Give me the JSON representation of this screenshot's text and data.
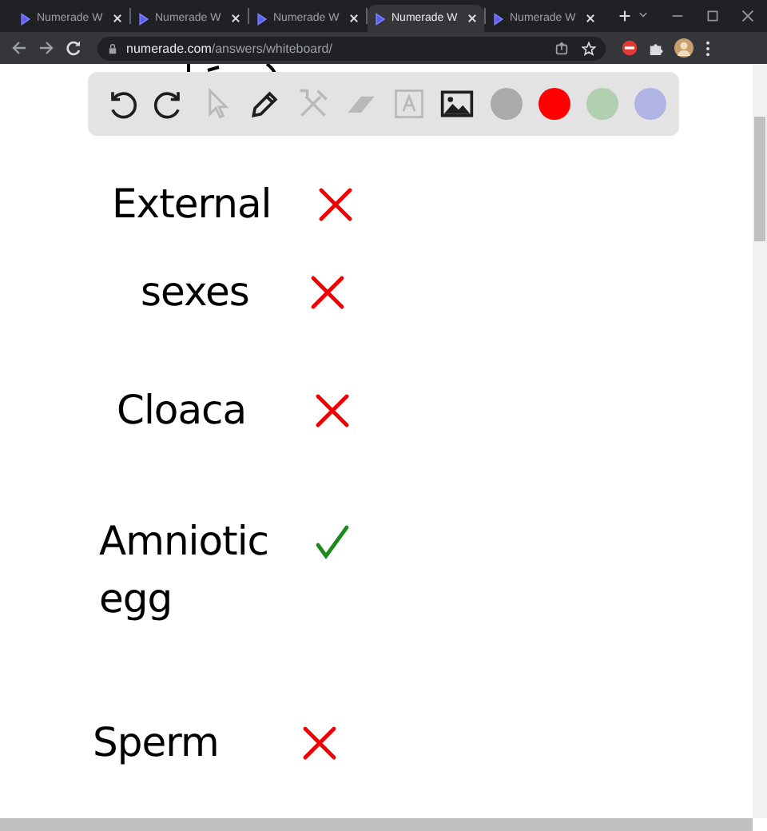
{
  "browser": {
    "tabs": [
      {
        "title": "Numerade W",
        "selected": false
      },
      {
        "title": "Numerade W",
        "selected": false
      },
      {
        "title": "Numerade W",
        "selected": false
      },
      {
        "title": "Numerade W",
        "selected": true
      },
      {
        "title": "Numerade W",
        "selected": false
      }
    ],
    "url_host": "numerade.com",
    "url_path": "/answers/whiteboard/"
  },
  "whiteboard_toolbar": {
    "tools": [
      {
        "kind": "undo",
        "disabled": false
      },
      {
        "kind": "redo",
        "disabled": false
      },
      {
        "kind": "pointer",
        "disabled": true
      },
      {
        "kind": "pencil",
        "disabled": false
      },
      {
        "kind": "tools",
        "disabled": true
      },
      {
        "kind": "eraser",
        "disabled": true
      },
      {
        "kind": "text",
        "disabled": true
      },
      {
        "kind": "image",
        "disabled": false
      }
    ],
    "colors": [
      {
        "color": "#aaaaaa"
      },
      {
        "color": "#ff0000"
      },
      {
        "color": "#b0d0b0"
      },
      {
        "color": "#b0b4e4"
      }
    ]
  },
  "board": {
    "entries": [
      {
        "lines": [
          "External"
        ],
        "correct": false
      },
      {
        "lines": [
          "sexes"
        ],
        "correct": false
      },
      {
        "lines": [
          "Cloaca"
        ],
        "correct": false
      },
      {
        "lines": [
          "Amniotic",
          "egg"
        ],
        "correct": true
      },
      {
        "lines": [
          "Sperm"
        ],
        "correct": false
      }
    ]
  }
}
